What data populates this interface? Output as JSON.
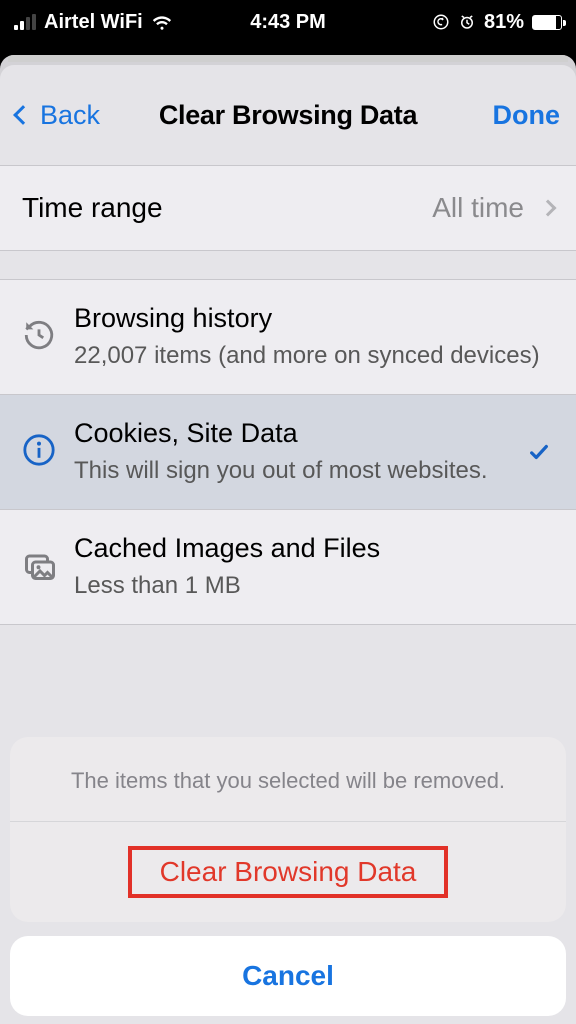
{
  "statusbar": {
    "carrier": "Airtel WiFi",
    "time": "4:43 PM",
    "battery_pct": "81%"
  },
  "nav": {
    "back": "Back",
    "title": "Clear Browsing Data",
    "done": "Done"
  },
  "time_range": {
    "label": "Time range",
    "value": "All time"
  },
  "items": [
    {
      "title": "Browsing history",
      "subtitle": "22,007 items (and more on synced devices)"
    },
    {
      "title": "Cookies, Site Data",
      "subtitle": "This will sign you out of most websites."
    },
    {
      "title": "Cached Images and Files",
      "subtitle": "Less than 1 MB"
    }
  ],
  "sheet": {
    "message": "The items that you selected will be removed.",
    "action": "Clear Browsing Data",
    "cancel": "Cancel"
  }
}
